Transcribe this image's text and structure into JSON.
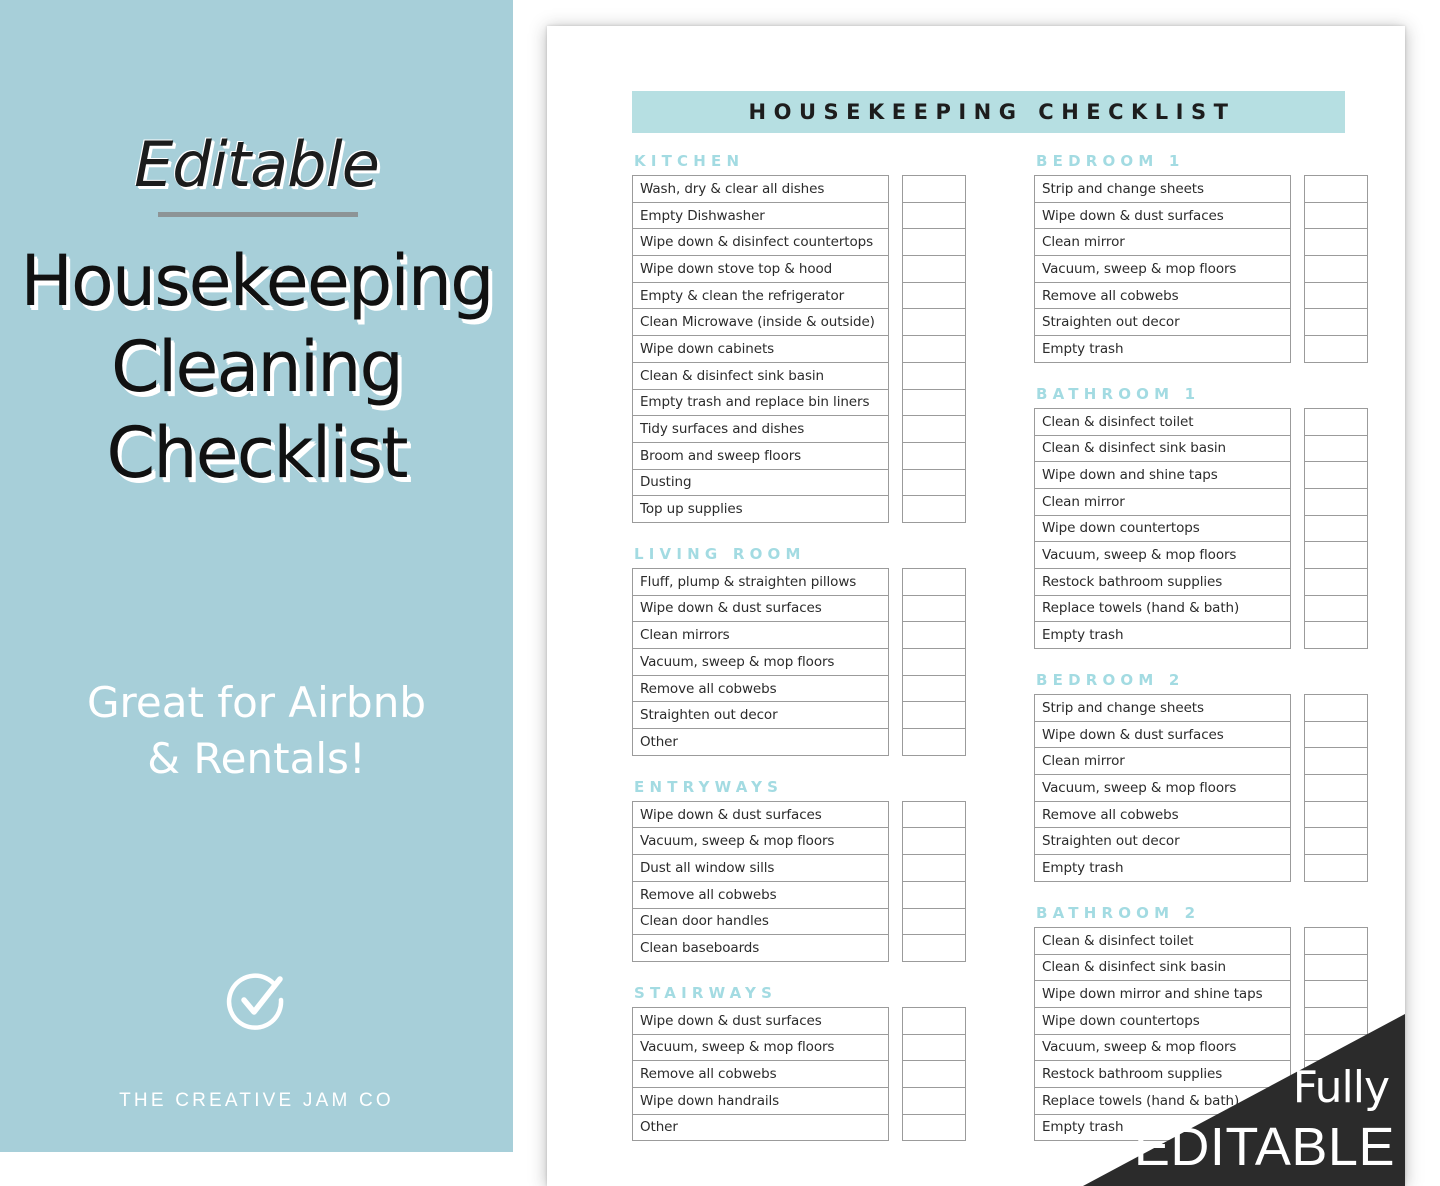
{
  "left_panel": {
    "kicker": "Editable",
    "title_lines": [
      "Housekeeping",
      "Cleaning",
      "Checklist"
    ],
    "tagline_lines": [
      "Great for Airbnb",
      "& Rentals!"
    ],
    "brand_mark_icon": "circle-check-icon",
    "brand_name": "THE CREATIVE JAM CO",
    "background_color": "#a7cfd9",
    "text_color": "#ffffff"
  },
  "badge": {
    "line1": "Fully",
    "line2": "EDITABLE",
    "background_color": "#2b2b2b",
    "text_color": "#ffffff"
  },
  "document": {
    "header_title": "HOUSEKEEPING  CHECKLIST",
    "header_background": "#b6dfe2",
    "section_title_color": "#a3dbe2",
    "border_color": "#9b9b9b",
    "columns": [
      {
        "sections": [
          {
            "title": "KITCHEN",
            "items": [
              "Wash, dry & clear all dishes",
              "Empty Dishwasher",
              "Wipe down & disinfect countertops",
              "Wipe down stove top & hood",
              "Empty & clean the refrigerator",
              "Clean Microwave (inside & outside)",
              "Wipe down cabinets",
              "Clean & disinfect sink basin",
              "Empty trash and replace bin liners",
              "Tidy surfaces and dishes",
              "Broom and sweep floors",
              "Dusting",
              "Top up supplies"
            ]
          },
          {
            "title": "LIVING ROOM",
            "items": [
              "Fluff, plump & straighten pillows",
              "Wipe down & dust surfaces",
              "Clean mirrors",
              "Vacuum, sweep & mop floors",
              "Remove all cobwebs",
              "Straighten out decor",
              "Other"
            ]
          },
          {
            "title": "ENTRYWAYS",
            "items": [
              "Wipe down & dust surfaces",
              "Vacuum, sweep & mop floors",
              "Dust all window sills",
              "Remove all cobwebs",
              "Clean door handles",
              "Clean baseboards"
            ]
          },
          {
            "title": "STAIRWAYS",
            "items": [
              "Wipe down & dust surfaces",
              "Vacuum, sweep & mop floors",
              "Remove all cobwebs",
              "Wipe down handrails",
              "Other"
            ]
          }
        ]
      },
      {
        "sections": [
          {
            "title": "BEDROOM 1",
            "items": [
              "Strip and change sheets",
              "Wipe down & dust surfaces",
              "Clean mirror",
              "Vacuum, sweep & mop floors",
              "Remove all cobwebs",
              "Straighten out decor",
              "Empty trash"
            ]
          },
          {
            "title": "BATHROOM 1",
            "items": [
              "Clean & disinfect toilet",
              "Clean & disinfect sink basin",
              "Wipe down and shine taps",
              "Clean mirror",
              "Wipe down countertops",
              "Vacuum, sweep & mop floors",
              "Restock bathroom supplies",
              "Replace towels (hand & bath)",
              "Empty trash"
            ]
          },
          {
            "title": "BEDROOM 2",
            "items": [
              "Strip and change sheets",
              "Wipe down & dust surfaces",
              "Clean mirror",
              "Vacuum, sweep & mop floors",
              "Remove all cobwebs",
              "Straighten out decor",
              "Empty trash"
            ]
          },
          {
            "title": "BATHROOM 2",
            "items": [
              "Clean & disinfect toilet",
              "Clean & disinfect sink basin",
              "Wipe down mirror and shine taps",
              "Wipe down countertops",
              "Vacuum, sweep & mop floors",
              "Restock bathroom supplies",
              "Replace towels (hand & bath)",
              "Empty trash"
            ]
          }
        ]
      }
    ]
  }
}
